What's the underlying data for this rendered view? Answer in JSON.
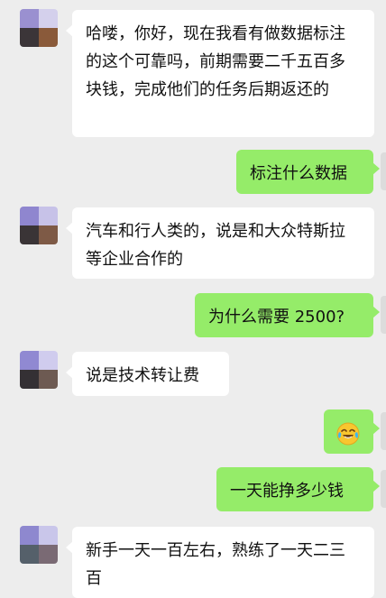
{
  "messages": [
    {
      "side": "left",
      "text": "哈喽，你好，现在我看有做数据标注的这个可靠吗，前期需要二千五百多块钱，完成他们的任务后期返还的"
    },
    {
      "side": "right",
      "text": "标注什么数据"
    },
    {
      "side": "left",
      "text": "汽车和行人类的，说是和大众特斯拉等企业合作的"
    },
    {
      "side": "right",
      "text": "为什么需要 2500?"
    },
    {
      "side": "left",
      "text": "说是技术转让费"
    },
    {
      "side": "right",
      "emoji": "face-with-tears-of-joy-emoji"
    },
    {
      "side": "right",
      "text": "一天能挣多少钱"
    },
    {
      "side": "left",
      "text": "新手一天一百左右，熟练了一天二三百"
    }
  ],
  "colors": {
    "background": "#ededed",
    "bubble_left": "#ffffff",
    "bubble_right": "#95ec69",
    "text": "#111111"
  }
}
